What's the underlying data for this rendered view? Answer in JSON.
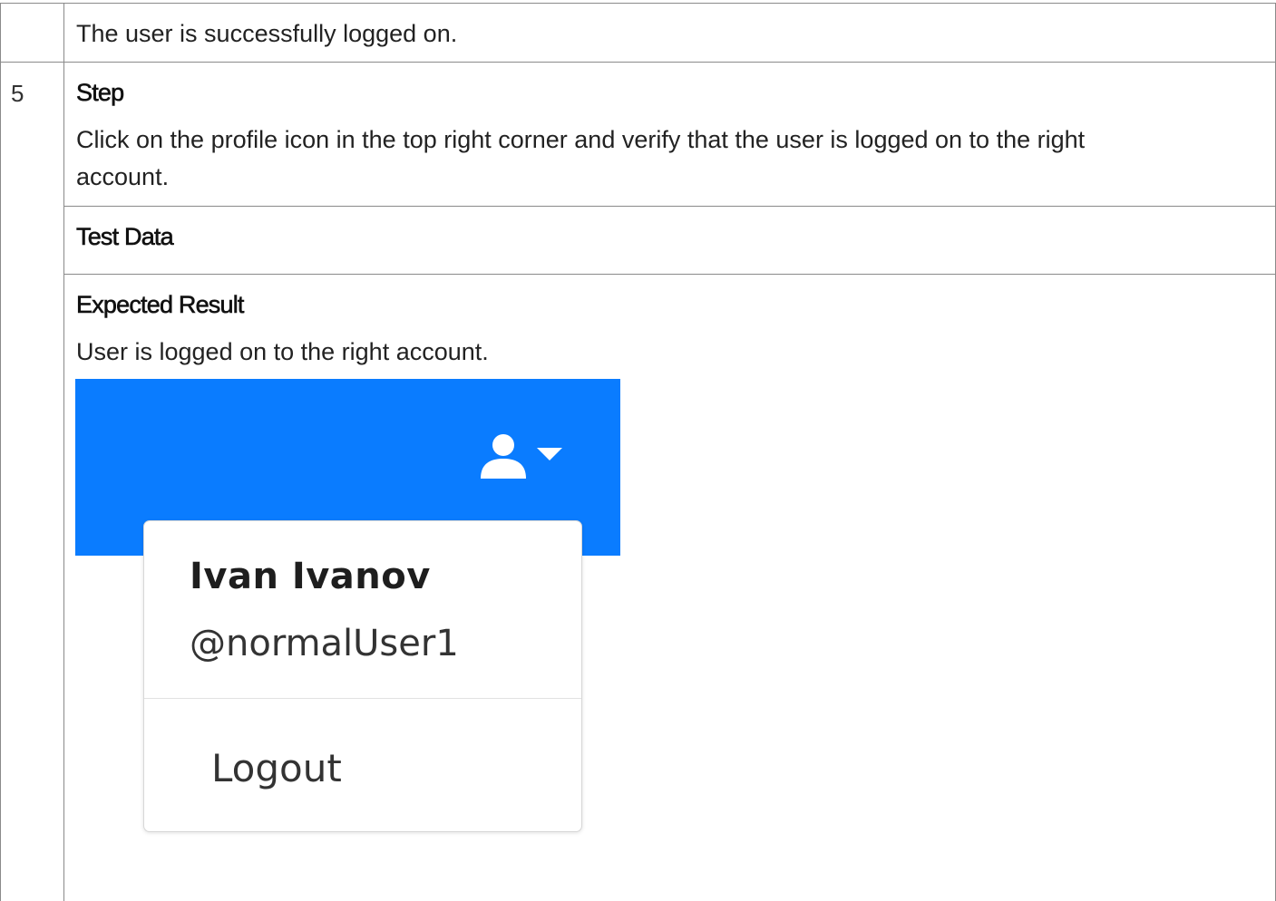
{
  "previous_row": {
    "result_text": "The user is successfully logged on."
  },
  "step_row": {
    "number": "5",
    "step_heading": "Step",
    "step_text_line1": "Click on the profile icon in the top right corner and verify that the user is logged on to the right",
    "step_text_line2": "account.",
    "test_data_heading": "Test Data",
    "expected_result_heading": "Expected Result",
    "expected_result_text": "User is logged on to the right account."
  },
  "screenshot": {
    "header_color": "#0a7cff",
    "profile_icon": "user-icon",
    "dropdown_icon": "caret-down-icon",
    "dropdown": {
      "full_name": "Ivan Ivanov",
      "username": "@normalUser1",
      "logout_label": "Logout"
    }
  }
}
